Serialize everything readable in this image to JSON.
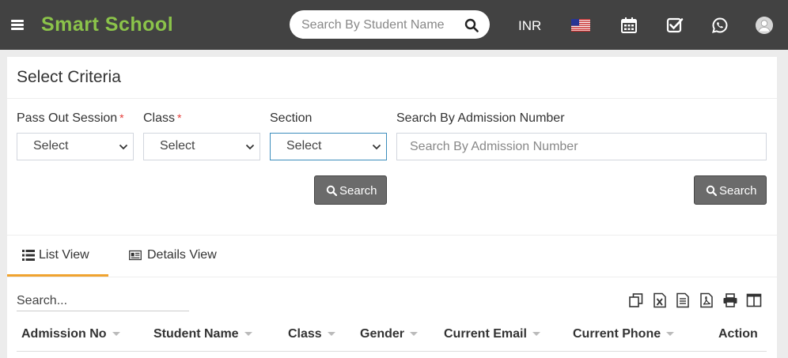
{
  "header": {
    "brand": "Smart School",
    "search_placeholder": "Search By Student Name",
    "currency": "INR",
    "icons": [
      "menu-icon",
      "search-icon",
      "us-flag-icon",
      "calendar-icon",
      "checkbox-icon",
      "whatsapp-icon",
      "user-avatar"
    ]
  },
  "criteria": {
    "title": "Select Criteria",
    "pass_out_label": "Pass Out Session",
    "class_label": "Class",
    "section_label": "Section",
    "admission_label": "Search By Admission Number",
    "required_mark": "*",
    "pass_out_value": "Select",
    "class_value": "Select",
    "section_value": "Select",
    "admission_placeholder": "Search By Admission Number",
    "search_button": "Search",
    "search_button_2": "Search"
  },
  "tabs": {
    "list": "List View",
    "details": "Details View"
  },
  "table": {
    "search_placeholder": "Search...",
    "columns": [
      "Admission No",
      "Student Name",
      "Class",
      "Gender",
      "Current Email",
      "Current Phone",
      "Action"
    ],
    "tools": [
      "copy-icon",
      "excel-icon",
      "csv-icon",
      "pdf-icon",
      "print-icon",
      "columns-icon"
    ]
  },
  "colors": {
    "topbar": "#424242",
    "brand": "#8bc34a",
    "button": "#6b6b6b",
    "active_tab": "#f0a32f",
    "required": "#e53935"
  }
}
